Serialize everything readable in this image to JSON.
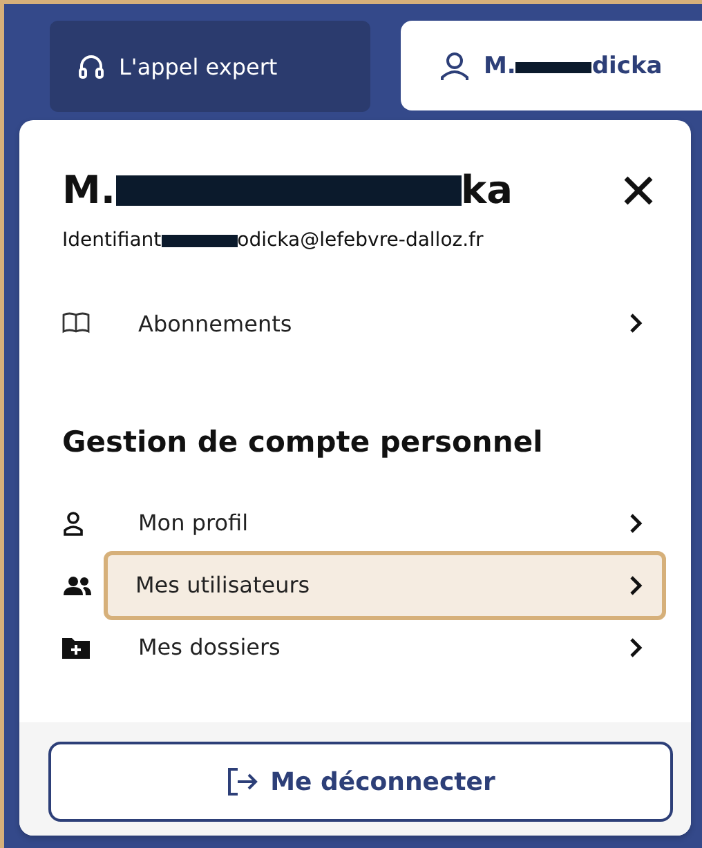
{
  "header": {
    "expert_button": {
      "label": "L'appel expert"
    },
    "user_button": {
      "label_start": "M.",
      "label_end": "dicka"
    }
  },
  "panel": {
    "name_start": "M.",
    "name_end": "ka",
    "id_start": "Identifiant",
    "id_end": "odicka@lefebvre-dalloz.fr",
    "links": [
      {
        "label": "Abonnements",
        "kind": "book",
        "selected": false
      }
    ],
    "section_title": "Gestion de compte personnel",
    "items": [
      {
        "label": "Mon profil",
        "kind": "person",
        "selected": false
      },
      {
        "label": "Mes utilisateurs",
        "kind": "people",
        "selected": true
      },
      {
        "label": "Mes dossiers",
        "kind": "folder",
        "selected": false
      }
    ],
    "logout": {
      "label": "Me déconnecter"
    }
  }
}
